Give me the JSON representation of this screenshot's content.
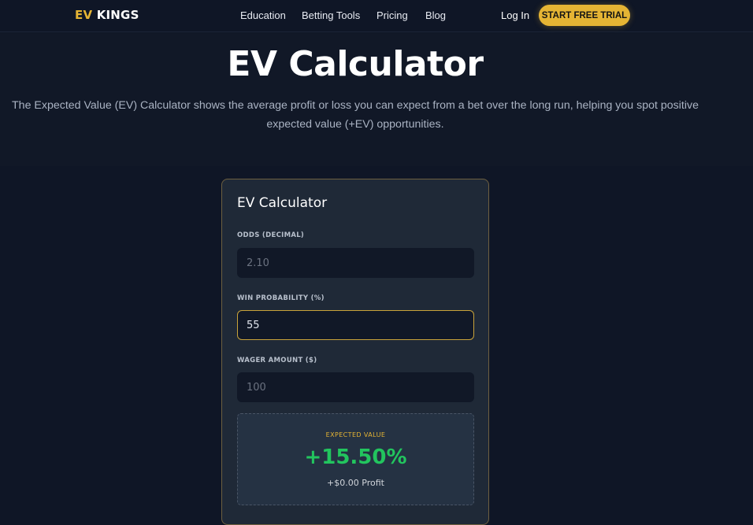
{
  "header": {
    "logo_ev": "EV",
    "logo_kings": "KINGS",
    "nav": [
      "Education",
      "Betting Tools",
      "Pricing",
      "Blog"
    ],
    "login": "Log In",
    "trial_button": "START FREE TRIAL"
  },
  "hero": {
    "title": "EV Calculator",
    "description": "The Expected Value (EV) Calculator shows the average profit or loss you can expect from a bet over the long run, helping you spot positive expected value (+EV) opportunities."
  },
  "calculator": {
    "title": "EV Calculator",
    "odds_label": "ODDS (DECIMAL)",
    "odds_placeholder": "2.10",
    "prob_label": "WIN PROBABILITY (%)",
    "prob_value": "55",
    "wager_label": "WAGER AMOUNT ($)",
    "wager_placeholder": "100",
    "result_label": "EXPECTED VALUE",
    "result_value": "+15.50%",
    "result_profit": "+$0.00 Profit"
  },
  "colors": {
    "accent": "#e5b434",
    "positive": "#22c55e",
    "background": "#0f1626",
    "card": "#1f2937"
  }
}
